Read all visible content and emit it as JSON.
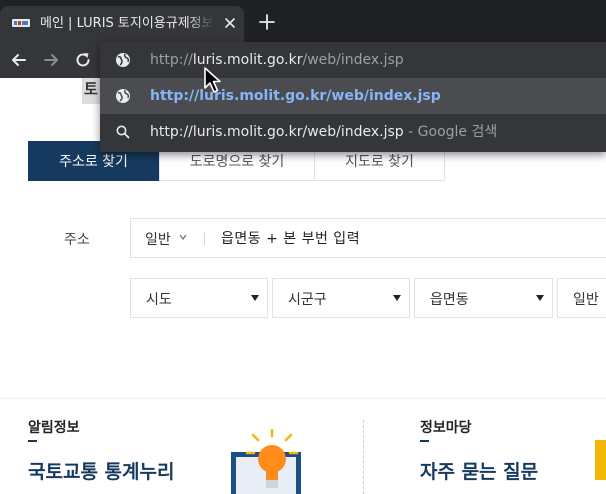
{
  "browser": {
    "tab": {
      "title": "메인 | LURIS 토지이용규제정보서비스",
      "favicon_icon": "luris-favicon-icon",
      "close_icon": "close-icon"
    },
    "new_tab_icon": "plus-icon",
    "nav": {
      "back_icon": "arrow-left-icon",
      "forward_icon": "arrow-right-icon",
      "reload_icon": "reload-icon"
    },
    "omnibox": {
      "input": {
        "scheme": "http://",
        "host": "luris.molit.go.kr",
        "path": "/web/index.jsp",
        "icon": "globe-icon"
      },
      "suggestions": [
        {
          "text": "http://luris.molit.go.kr/web/index.jsp",
          "icon": "globe-icon",
          "selected": true
        },
        {
          "text": "http://luris.molit.go.kr/web/index.jsp",
          "suffix": " - Google 검색",
          "icon": "search-icon"
        }
      ]
    }
  },
  "page": {
    "heading_fragment": "토",
    "search_tabs": [
      {
        "label": "주소로 찾기",
        "active": true
      },
      {
        "label": "도로명으로 찾기",
        "active": false
      },
      {
        "label": "지도로 찾기",
        "active": false
      }
    ],
    "address": {
      "label": "주소",
      "type_value": "일반",
      "placeholder": "읍면동 + 본 부번 입력"
    },
    "selects": [
      {
        "label": "시도"
      },
      {
        "label": "시군구"
      },
      {
        "label": "읍면동"
      },
      {
        "label": "일반"
      }
    ],
    "sections": {
      "notice": {
        "title": "알림정보",
        "link": "국토교통 통계누리"
      },
      "info": {
        "title": "정보마당",
        "link": "자주 묻는 질문"
      }
    },
    "colors": {
      "primary": "#163a5f",
      "accent": "#f2b705",
      "chrome_dark": "#202124",
      "link_blue": "#8ab4f8"
    }
  }
}
